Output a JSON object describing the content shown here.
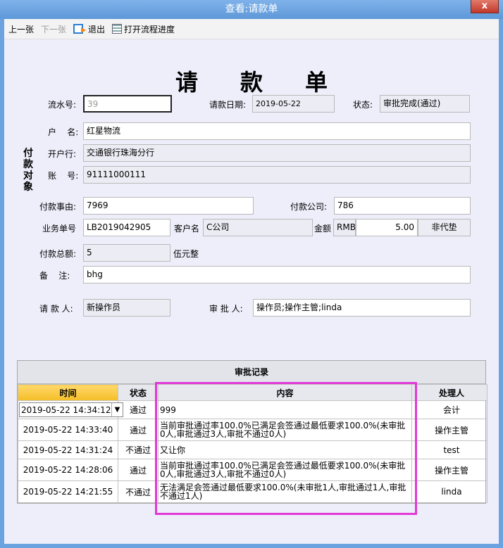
{
  "window": {
    "title": "查看:请款单",
    "close_label": "x"
  },
  "toolbar": {
    "prev": "上一张",
    "next": "下一张",
    "exit": "退出",
    "flow": "打开流程进度"
  },
  "form": {
    "title": "请款单",
    "serial_label": "流水号:",
    "serial_value": "39",
    "date_label": "请款日期:",
    "date_value": "2019-05-22",
    "status_label": "状态:",
    "status_value": "审批完成(通过)",
    "payee_group_label": "付款对象",
    "account_name_label": "户    名:",
    "account_name_value": "红星物流",
    "bank_label": "开户行:",
    "bank_value": "交通银行珠海分行",
    "account_no_label": "账    号:",
    "account_no_value": "91111000111",
    "reason_label": "付款事由:",
    "reason_value": "7969",
    "company_label": "付款公司:",
    "company_value": "786",
    "order_label": "业务单号",
    "order_value": "LB2019042905",
    "customer_label": "客户名",
    "customer_value": "C公司",
    "amount_label": "金额",
    "currency_value": "RMB",
    "amount_value": "5.00",
    "advance_value": "非代垫",
    "total_label": "付款总额:",
    "total_value": "5",
    "total_words": "伍元整",
    "remark_label": "备    注:",
    "remark_value": "bhg",
    "applicant_label": "请 款 人:",
    "applicant_value": "新操作员",
    "approver_label": "审 批 人:",
    "approver_value": "操作员;操作主管;linda"
  },
  "records": {
    "title": "审批记录",
    "columns": [
      "时间",
      "状态",
      "内容",
      "处理人"
    ],
    "rows": [
      {
        "time": "2019-05-22 14:34:12",
        "status": "通过",
        "content": "999",
        "handler": "会计"
      },
      {
        "time": "2019-05-22 14:33:40",
        "status": "通过",
        "content": "当前审批通过率100.0%已满足会签通过最低要求100.0%(未审批0人,审批通过3人,审批不通过0人)",
        "handler": "操作主管"
      },
      {
        "time": "2019-05-22 14:31:24",
        "status": "不通过",
        "content": "又让你",
        "handler": "test"
      },
      {
        "time": "2019-05-22 14:28:06",
        "status": "通过",
        "content": "当前审批通过率100.0%已满足会签通过最低要求100.0%(未审批0人,审批通过3人,审批不通过0人)",
        "handler": "操作主管"
      },
      {
        "time": "2019-05-22 14:21:55",
        "status": "不通过",
        "content": "无法满足会签通过最低要求100.0%(未审批1人,审批通过1人,审批不通过1人)",
        "handler": "linda"
      }
    ]
  },
  "colors": {
    "highlight": "#e239d6",
    "active_header": "#f5be28",
    "titlebar": "#6aa3e0"
  }
}
